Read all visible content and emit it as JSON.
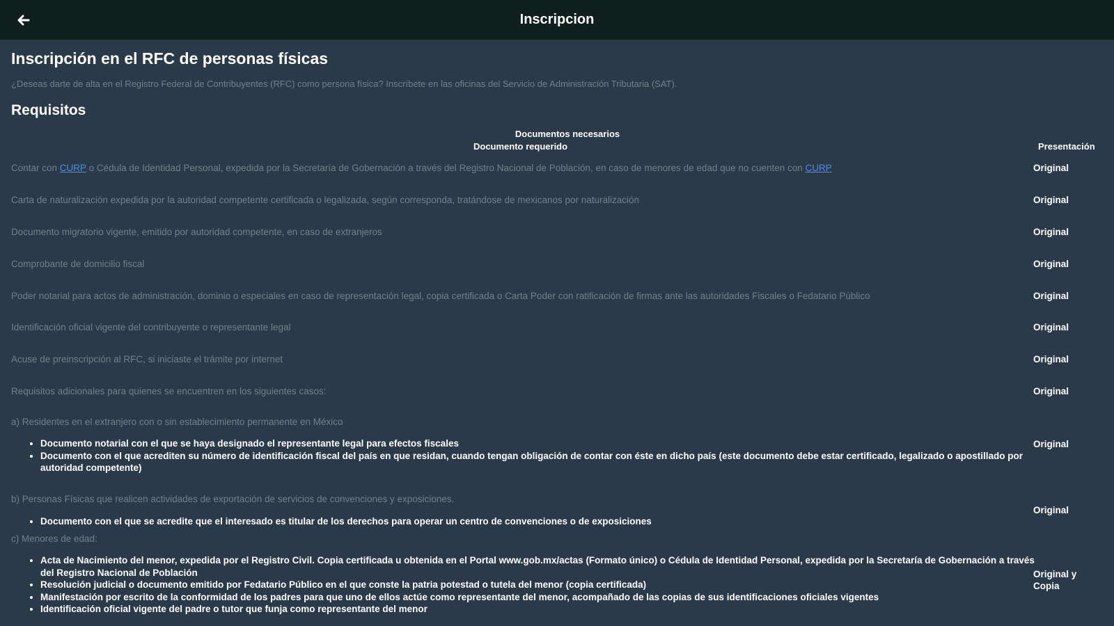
{
  "appbar": {
    "title": "Inscripcion",
    "back_icon": "arrow-left-icon"
  },
  "page": {
    "heading": "Inscripción en el RFC de personas físicas",
    "intro": "¿Deseas darte de alta en el Registro Federal de Contribuyentes (RFC) como persona física? Inscríbete en las oficinas del Servicio de Administración Tributaria (SAT).",
    "requisitos_heading": "Requisitos"
  },
  "table": {
    "caption": "Documentos necesarios",
    "col_doc": "Documento requerido",
    "col_pres": "Presentación",
    "row1": {
      "text_a": "Contar con ",
      "link1": "CURP",
      "text_b": " o Cédula de Identidad Personal, expedida por la Secretaría de Gobernación a través del Registro Nacional de Población, en caso de menores de edad que no cuenten con ",
      "link2": "CURP",
      "pres": "Original"
    },
    "rows": [
      {
        "text": "Carta de naturalización expedida por la autoridad competente certificada o legalizada, según corresponda, tratándose de mexicanos por naturalización",
        "pres": "Original"
      },
      {
        "text": "Documento migratorio vigente, emitido por autoridad competente, en caso de extranjeros",
        "pres": "Original"
      },
      {
        "text": "Comprobante de domicilio fiscal",
        "pres": "Original"
      },
      {
        "text": "Poder notarial para actos de administración, dominio o especiales en caso de representación legal, copia certificada o Carta Poder con ratificación de firmas ante las autoridades Fiscales o Fedatario Público",
        "pres": "Original"
      },
      {
        "text": "Identificación oficial vigente del contribuyente o representante legal",
        "pres": "Original"
      },
      {
        "text": "Acuse de preinscripción al RFC, si iniciaste el trámite por internet",
        "pres": "Original"
      },
      {
        "text": "Requisitos adicionales para quienes se encuentren en los siguientes casos:",
        "pres": "Original"
      }
    ],
    "section_a": {
      "title": "a) Residentes en el extranjero con o sin establecimiento permanente en México",
      "items": [
        "Documento notarial con el que se haya designado el representante legal para efectos fiscales",
        "Documento con el que acrediten su número de identificación fiscal del país en que residan, cuando tengan obligación de contar con éste en dicho país (este documento debe estar certificado, legalizado o apostillado por autoridad competente)"
      ],
      "pres": "Original"
    },
    "section_b": {
      "title": "b) Personas Físicas que realicen actividades de exportación de servicios de convenciones y exposiciones.",
      "items": [
        "Documento con el que se acredite que el interesado es titular de los derechos para operar un centro de convenciones o de exposiciones"
      ],
      "pres": "Original"
    },
    "section_c": {
      "title": "c) Menores de edad:",
      "items": [
        "Acta de Nacimiento del menor, expedida por el Registro Civil. Copia certificada u obtenida en el Portal www.gob.mx/actas (Formato único) o Cédula de Identidad Personal, expedida por la Secretaría de Gobernación a través del Registro Nacional de Población",
        "Resolución judicial o documento emitido por Fedatario Público en el que conste la patria potestad o tutela del menor (copia certificada)",
        "Manifestación por escrito de la conformidad de los padres para que uno de ellos actúe como representante del menor, acompañado de las copias de sus identificaciones oficiales vigentes",
        "Identificación oficial vigente del padre o tutor que funja como representante del menor"
      ],
      "pres": "Original y Copia"
    }
  }
}
